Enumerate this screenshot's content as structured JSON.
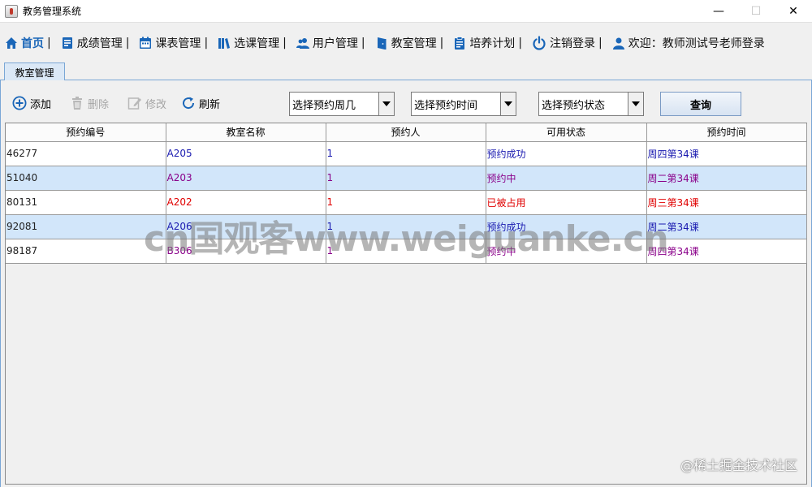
{
  "window": {
    "title": "教务管理系统",
    "controls": {
      "minimize": "—",
      "maximize": "☐",
      "close": "✕"
    }
  },
  "menu": {
    "items": [
      {
        "label": "首页",
        "icon": "home-icon",
        "active": true
      },
      {
        "label": "成绩管理",
        "icon": "grades-icon"
      },
      {
        "label": "课表管理",
        "icon": "calendar-icon"
      },
      {
        "label": "选课管理",
        "icon": "books-icon"
      },
      {
        "label": "用户管理",
        "icon": "users-icon"
      },
      {
        "label": "教室管理",
        "icon": "door-icon"
      },
      {
        "label": "培养计划",
        "icon": "clipboard-icon"
      },
      {
        "label": "注销登录",
        "icon": "power-icon"
      }
    ],
    "separator": "|",
    "welcome": {
      "label": "欢迎：教师测试号老师登录",
      "icon": "user-icon"
    }
  },
  "tabs": [
    {
      "label": "教室管理"
    }
  ],
  "toolbar": {
    "add": "添加",
    "delete": "删除",
    "edit": "修改",
    "refresh": "刷新",
    "week_select": "选择预约周几",
    "time_select": "选择预约时间",
    "status_select": "选择预约状态",
    "query": "查询"
  },
  "table": {
    "columns": [
      "预约编号",
      "教室名称",
      "预约人",
      "可用状态",
      "预约时间"
    ],
    "rows": [
      [
        "46277",
        "A205",
        "1",
        "预约成功",
        "周四第34课"
      ],
      [
        "51040",
        "A203",
        "1",
        "预约中",
        "周二第34课"
      ],
      [
        "80131",
        "A202",
        "1",
        "已被占用",
        "周三第34课"
      ],
      [
        "92081",
        "A206",
        "1",
        "预约成功",
        "周二第34课"
      ],
      [
        "98187",
        "B306",
        "1",
        "预约中",
        "周四第34课"
      ]
    ]
  },
  "colors": {
    "success": "#1a1ab0",
    "pending": "#8a008a",
    "occupied": "#e00000",
    "selected_row": "#d2e6fa",
    "accent": "#1a66b8"
  },
  "overlay": {
    "watermark": "cn国观客www.weiguanke.cn",
    "credit": "@稀土掘金技术社区"
  }
}
